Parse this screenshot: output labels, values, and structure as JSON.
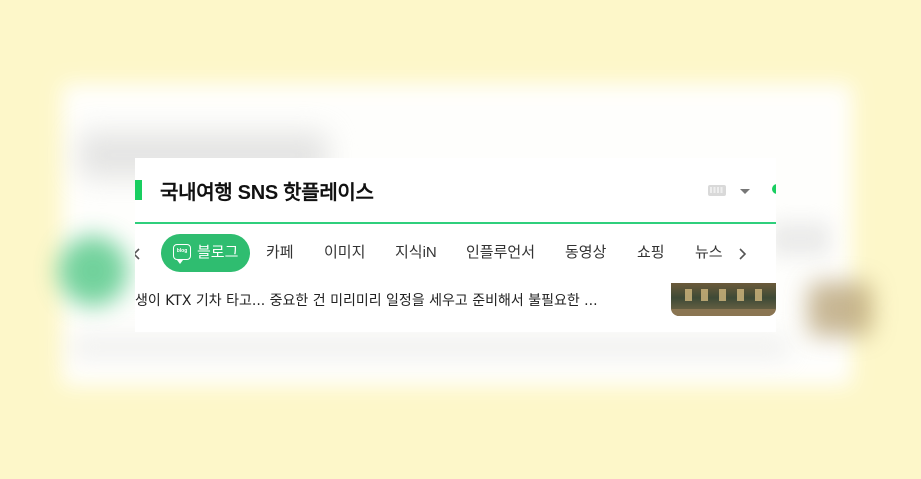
{
  "header": {
    "title": "국내여행 SNS 핫플레이스"
  },
  "toolbar": {
    "keyboard_icon": "keyboard-icon",
    "dropdown_icon": "caret-down-icon"
  },
  "tabs": [
    {
      "label": "블로그",
      "active": true,
      "icon": "blog-icon"
    },
    {
      "label": "카페"
    },
    {
      "label": "이미지"
    },
    {
      "label": "지식iN"
    },
    {
      "label": "인플루언서"
    },
    {
      "label": "동영상"
    },
    {
      "label": "쇼핑"
    },
    {
      "label": "뉴스"
    }
  ],
  "tab_icon_text": "blog",
  "result": {
    "snippet": "생이 KTX 기차 타고... 중요한 건 미리미리 일정을 세우고 준비해서 불필요한 ..."
  },
  "colors": {
    "accent": "#19ce60",
    "active_tab": "#2fbd70",
    "background": "#fdf7c9"
  }
}
